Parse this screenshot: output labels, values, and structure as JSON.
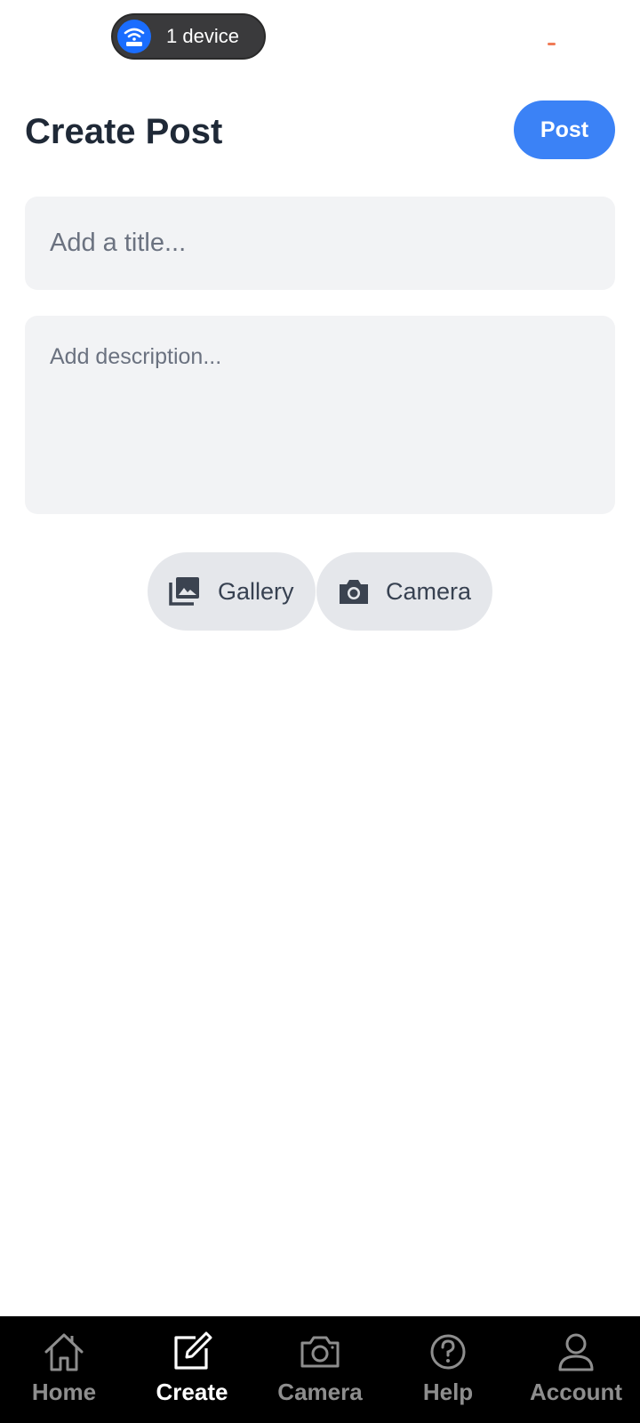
{
  "status_bar": {
    "device_pill_label": "1 device",
    "device_pill_icon": "wifi-router-icon",
    "indicator_color": "#f07b56"
  },
  "header": {
    "title": "Create Post",
    "post_button_label": "Post"
  },
  "form": {
    "title_placeholder": "Add a title...",
    "title_value": "",
    "description_placeholder": "Add description...",
    "description_value": ""
  },
  "media_buttons": {
    "gallery_label": "Gallery",
    "gallery_icon": "gallery-icon",
    "camera_label": "Camera",
    "camera_icon": "camera-icon"
  },
  "bottom_nav": {
    "active": "Create",
    "items": [
      {
        "label": "Home",
        "icon": "home-icon"
      },
      {
        "label": "Create",
        "icon": "edit-icon"
      },
      {
        "label": "Camera",
        "icon": "camera-icon"
      },
      {
        "label": "Help",
        "icon": "help-icon"
      },
      {
        "label": "Account",
        "icon": "account-icon"
      }
    ]
  },
  "colors": {
    "accent": "#3b82f6",
    "title_text": "#1f2937",
    "field_background": "#f2f3f5",
    "media_button_background": "#e5e7eb",
    "nav_background": "#000000",
    "nav_inactive": "#8e8e8e",
    "nav_active": "#ffffff"
  }
}
